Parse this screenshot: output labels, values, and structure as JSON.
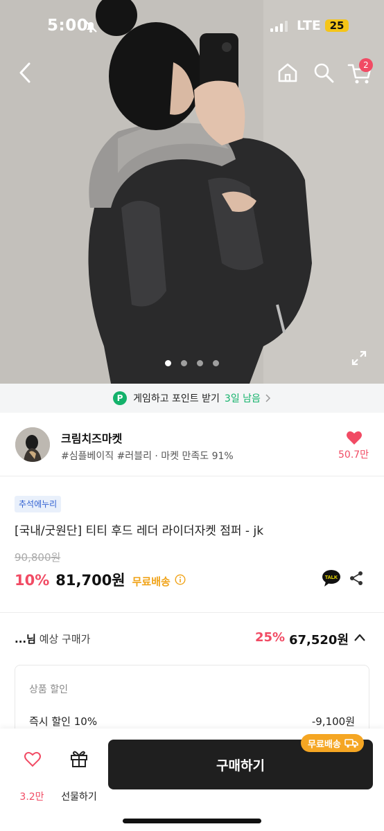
{
  "status_bar": {
    "time": "5:00",
    "network": "LTE",
    "battery": "25"
  },
  "top_nav": {
    "cart_count": "2"
  },
  "gallery": {
    "current_index": 1,
    "total": 4
  },
  "game_banner": {
    "text": "게임하고 포인트 받기",
    "days_left": "3일 남음",
    "icon_letter": "P"
  },
  "seller": {
    "name": "크림치즈마켓",
    "meta": "#심플베이직 #러블리 · 마켓 만족도 91%",
    "likes": "50.7만"
  },
  "product": {
    "badge": "추석에누리",
    "title": "[국내/굿원단] 티티 후드 레더 라이더자켓 점퍼 - jk",
    "original_price": "90,800원",
    "discount": "10%",
    "price": "81,700원",
    "free_shipping": "무료배송",
    "talk_label": "TALK"
  },
  "expected": {
    "label_name": "...님",
    "label_text": "예상 구매가",
    "discount": "25%",
    "price": "67,520원",
    "box_title": "상품 할인",
    "item_label": "즉시 할인 10%",
    "item_value": "-9,100원"
  },
  "bottom_bar": {
    "like_count": "3.2만",
    "gift_label": "선물하기",
    "buy_label": "구매하기",
    "shipping_tag": "무료배송"
  },
  "colors": {
    "accent": "#f14b64",
    "green": "#14b26b",
    "orange": "#f5a623",
    "dark": "#1f1f1f"
  }
}
